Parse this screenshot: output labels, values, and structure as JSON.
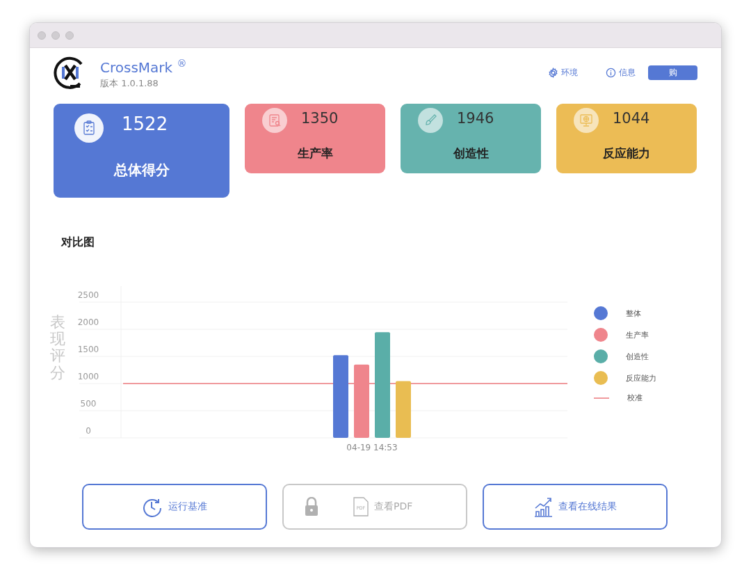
{
  "app": {
    "title": "CrossMark $^{®}$",
    "version": "版本 1.0.1.88"
  },
  "header_links": [
    {
      "kind": "settings",
      "label": "环境"
    },
    {
      "kind": "info",
      "label": "信息"
    }
  ],
  "buy_button": {
    "label": "购"
  },
  "score_cards": [
    {
      "kind": "overall",
      "score": "1522",
      "label": "总体得分",
      "color": "#5578d4"
    },
    {
      "kind": "productivity",
      "score": "1350",
      "label": "生产率",
      "color": "#ef858c"
    },
    {
      "kind": "creativity",
      "score": "1946",
      "label": "创造性",
      "color": "#66b3ae"
    },
    {
      "kind": "responsiveness",
      "score": "1044",
      "label": "反应能力",
      "color": "#ecbc55"
    }
  ],
  "comparison": {
    "title": "对比图",
    "chart_data": {
      "type": "bar",
      "ylabel": "表现评分",
      "categories": [
        "04-19 14:53"
      ],
      "ylim": [
        0,
        2500
      ],
      "yticks": [
        0,
        500,
        1000,
        1500,
        2000,
        2500
      ],
      "series": [
        {
          "name": "整体",
          "color": "#5578d4",
          "values": [
            1522
          ]
        },
        {
          "name": "生产率",
          "color": "#ef858c",
          "values": [
            1350
          ]
        },
        {
          "name": "创造性",
          "color": "#5aaea8",
          "values": [
            1946
          ]
        },
        {
          "name": "反应能力",
          "color": "#e9bd52",
          "values": [
            1044
          ]
        }
      ],
      "grid": true,
      "ref_lines": [
        {
          "axis": "y",
          "value": 1000,
          "label": "校准",
          "color": "#f09a9d"
        }
      ]
    }
  },
  "actions": [
    {
      "kind": "run",
      "label": "运行基准",
      "disabled": false
    },
    {
      "kind": "pdf",
      "label": "查看PDF",
      "icon_text": "PDF",
      "disabled": true
    },
    {
      "kind": "online",
      "label": "查看在线结果",
      "disabled": false
    }
  ]
}
